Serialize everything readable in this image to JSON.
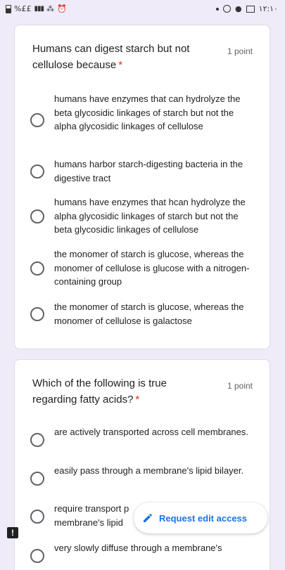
{
  "status_bar": {
    "left_text": "%££",
    "time": "١٢:١٠"
  },
  "questions": [
    {
      "title": "Humans can digest starch but not cellulose because",
      "required_mark": "*",
      "points": "1 point",
      "options": [
        "humans have enzymes that can hydrolyze the beta glycosidic linkages of starch but not the alpha glycosidic linkages of cellulose",
        "humans harbor starch-digesting bacteria in the digestive tract",
        "humans have enzymes that hcan hydrolyze the alpha glycosidic linkages of starch but not the beta glycosidic linkages of cellulose",
        "the monomer of starch is glucose, whereas the monomer of cellulose is glucose with a nitrogen-containing group",
        "the monomer of starch is glucose, whereas the monomer of cellulose is galactose"
      ]
    },
    {
      "title": "Which of the following is true regarding fatty acids?",
      "required_mark": "*",
      "points": "1 point",
      "options": [
        "are actively transported across cell membranes.",
        "easily pass through a membrane's lipid bilayer.",
        "require transport p membrane's lipid",
        "very slowly diffuse through a membrane's"
      ]
    }
  ],
  "request_edit_access": {
    "label": "Request edit access",
    "icon": "pencil-icon"
  },
  "alert_badge": {
    "icon": "exclamation-icon",
    "text": "!"
  }
}
